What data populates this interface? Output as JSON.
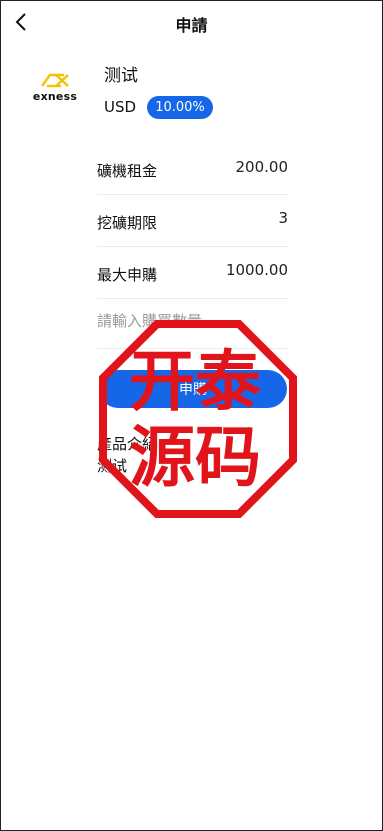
{
  "header": {
    "title": "申請"
  },
  "product": {
    "logo_text": "exness",
    "name": "测试",
    "currency": "USD",
    "rate": "10.00%"
  },
  "details": [
    {
      "label": "礦機租金",
      "value": "200.00"
    },
    {
      "label": "挖礦期限",
      "value": "3"
    },
    {
      "label": "最大申購",
      "value": "1000.00"
    }
  ],
  "quantity": {
    "placeholder": "請輸入購買數量",
    "value": ""
  },
  "submit_label": "申購",
  "intro": {
    "title": "產品介紹",
    "body": "测试"
  },
  "watermark": {
    "line1": "开泰",
    "line2": "源码"
  },
  "colors": {
    "accent": "#1666e8",
    "stamp": "#e0141a",
    "logo": "#f2c400"
  }
}
